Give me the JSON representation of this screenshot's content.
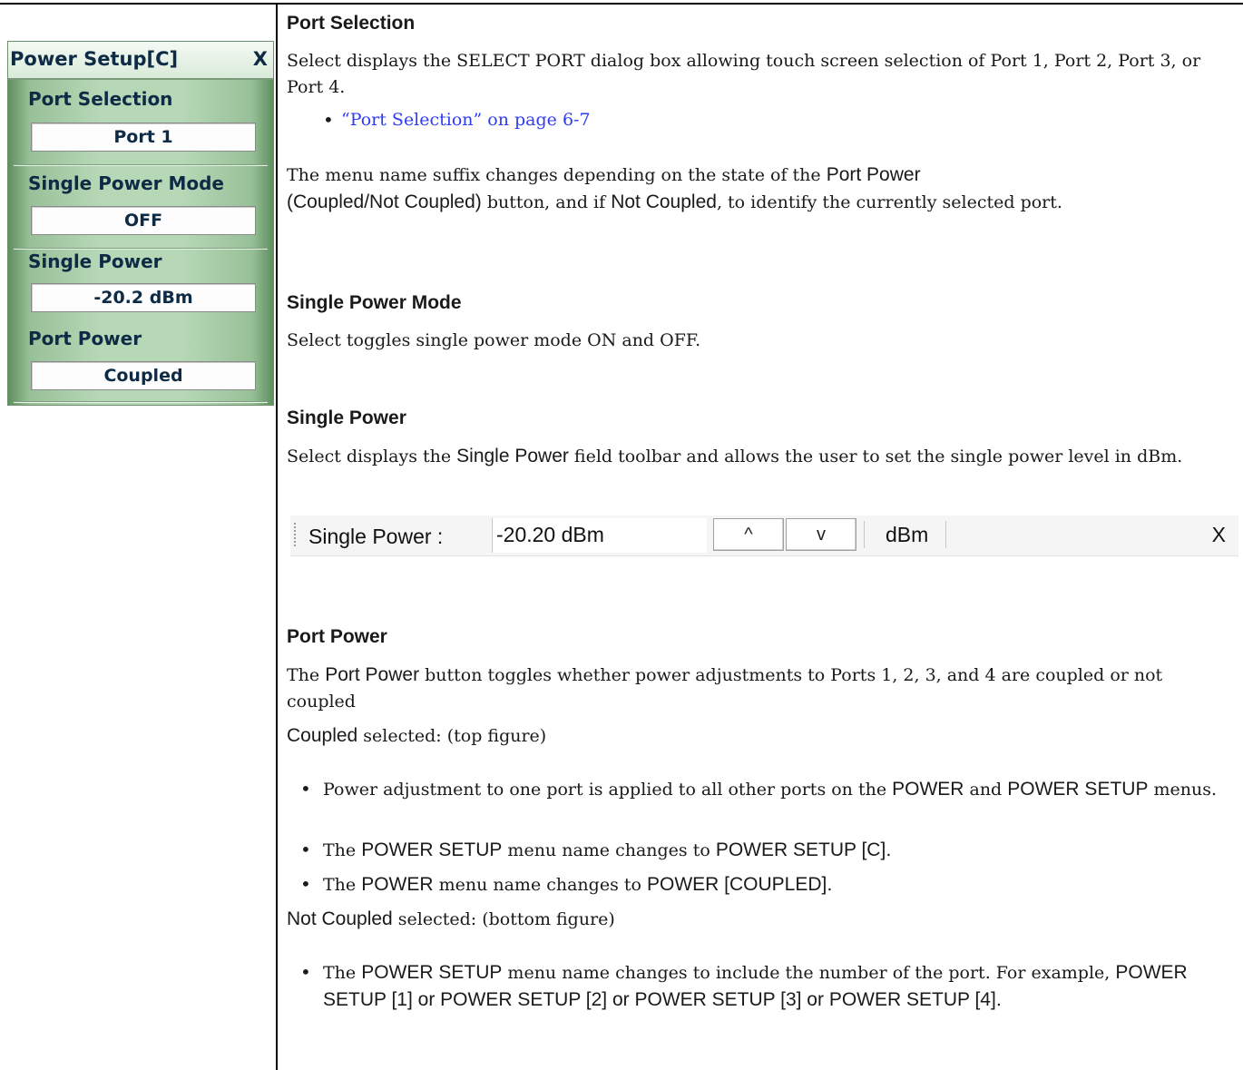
{
  "menu": {
    "title": "Power Setup[C]",
    "close": "X",
    "items": [
      {
        "label": "Port Selection",
        "value": "Port 1"
      },
      {
        "label": "Single Power Mode",
        "value": "OFF"
      },
      {
        "label": "Single Power",
        "value": "-20.2  dBm"
      },
      {
        "label": "Port Power",
        "value": "Coupled"
      }
    ]
  },
  "sections": {
    "port_selection": {
      "heading": "Port Selection",
      "para1": "Select displays the SELECT PORT dialog box allowing touch screen selection of Port 1, Port 2, Port 3, or Port 4.",
      "link": "“Port Selection” on page 6-7",
      "para2_a": "The menu name suffix changes depending on the state of the ",
      "para2_b": "Port Power",
      "para2_c": "(Coupled/Not Coupled)",
      "para2_d": " button, and if ",
      "para2_e": "Not Coupled",
      "para2_f": ", to identify the currently selected port."
    },
    "single_power_mode": {
      "heading": "Single Power Mode",
      "para": "Select toggles single power mode ON and OFF."
    },
    "single_power": {
      "heading": "Single Power",
      "para_a": "Select displays the ",
      "para_b": "Single Power",
      "para_c": " field toolbar and allows the user to set the single power level in dBm."
    },
    "port_power": {
      "heading": "Port Power",
      "para_a": "The ",
      "para_b": "Port Power",
      "para_c": " button toggles whether power adjustments to Ports 1, 2, 3, and 4 are coupled or not coupled",
      "coupled_a": "Coupled",
      "coupled_b": " selected: (top figure)",
      "bullets_coupled": {
        "b1_a": "Power adjustment to one port is applied to all other ports on the ",
        "b1_b": "POWER",
        "b1_c": " and ",
        "b1_d": "POWER SETUP",
        "b1_e": " menus.",
        "b2_a": "The ",
        "b2_b": "POWER SETUP",
        "b2_c": " menu name changes to ",
        "b2_d": "POWER SETUP [C]",
        "b2_e": ".",
        "b3_a": "The ",
        "b3_b": "POWER",
        "b3_c": " menu name changes to ",
        "b3_d": "POWER [COUPLED]",
        "b3_e": "."
      },
      "not_coupled_a": "Not Coupled",
      "not_coupled_b": " selected: (bottom figure)",
      "bullet_nc": {
        "a": "The ",
        "b": "POWER SETUP",
        "c": " menu name changes to include the number of the port. For example, ",
        "d": "POWER SETUP [1] or POWER SETUP [2] or POWER SETUP [3] or POWER SETUP [4]",
        "e": "."
      }
    }
  },
  "toolbar": {
    "label": "Single Power  :",
    "input_value": "-20.20  dBm",
    "up": "^",
    "down": "v",
    "unit": "dBm",
    "close": "X"
  },
  "bullet_char": "•"
}
